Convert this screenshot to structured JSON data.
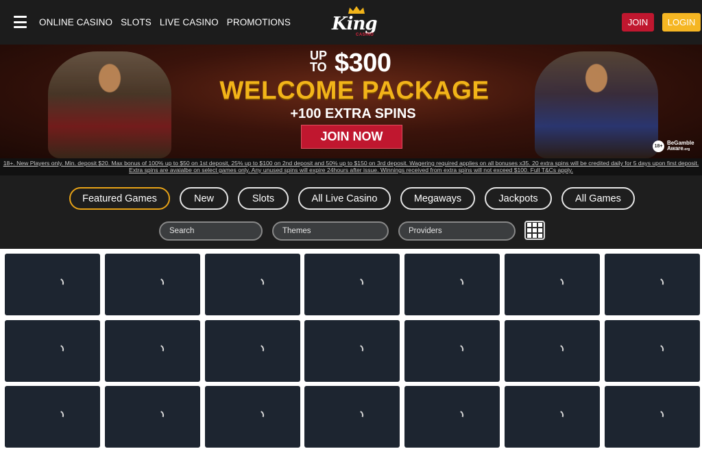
{
  "header": {
    "nav": [
      "ONLINE CASINO",
      "SLOTS",
      "LIVE CASINO",
      "PROMOTIONS"
    ],
    "logo_text": "King",
    "logo_sub": "CASINO",
    "join_label": "JOIN",
    "login_label": "LOGIN",
    "colors": {
      "join": "#c0172f",
      "login": "#f5b623"
    }
  },
  "banner": {
    "up_line1": "UP",
    "up_line2": "TO",
    "amount": "$300",
    "package": "WELCOME PACKAGE",
    "spins": "+100 EXTRA SPINS",
    "cta": "JOIN NOW",
    "age_badge": "18+",
    "begamble_line1": "BeGamble",
    "begamble_line2": "Aware",
    "begamble_org": ".org",
    "terms": "18+. New Players only. Min. deposit $20. Max bonus of 100% up to $50 on 1st deposit, 25% up to $100 on 2nd deposit and 50% up to $150 on 3rd deposit. Wagering required applies on all bonuses x35. 20 extra spins will be credited daily for 5 days upon first deposit. Extra spins are avaialbe on select games only. Any unused spins will expire 24hours after issue. Winnings received from extra spins will not exceed $100. Full T&Cs apply."
  },
  "filters": {
    "categories": [
      "Featured Games",
      "New",
      "Slots",
      "All Live Casino",
      "Megaways",
      "Jackpots",
      "All Games"
    ],
    "active_category": "Featured Games",
    "search_placeholder": "Search",
    "themes_label": "Themes",
    "providers_label": "Providers"
  },
  "games": {
    "rows": 3,
    "cols": 7,
    "state": "loading"
  }
}
